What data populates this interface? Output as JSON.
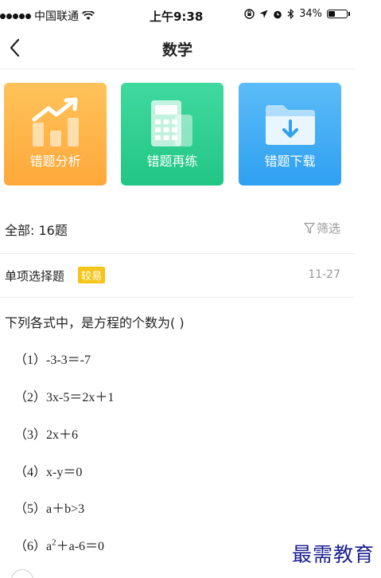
{
  "status_bar": {
    "carrier": "中国联通",
    "time": "上午9:38",
    "battery_text": "34%",
    "battery_level": 0.34
  },
  "nav": {
    "title": "数学",
    "back_icon": "chevron-left-icon"
  },
  "cards": [
    {
      "label": "错题分析",
      "icon": "bar-chart-trend-icon",
      "color": "#ffb347"
    },
    {
      "label": "错题再练",
      "icon": "calculator-icon",
      "color": "#2ecc8f"
    },
    {
      "label": "错题下载",
      "icon": "folder-download-icon",
      "color": "#3aaaf5"
    }
  ],
  "summary": {
    "total": "全部: 16题",
    "filter_label": "筛选",
    "filter_icon": "funnel-icon"
  },
  "question": {
    "type": "单项选择题",
    "difficulty": "较易",
    "date": "11-27",
    "stem": "下列各式中，是方程的个数为( )",
    "options": [
      "（1）-3-3＝-7",
      "（2）3x-5＝2x＋1",
      "（3）2x＋6",
      "（4）x-y＝0",
      "（5）a＋b>3"
    ],
    "option6_prefix": "（6）a",
    "option6_sup": "2",
    "option6_suffix": "＋a-6＝0"
  },
  "watermark": "最需教育"
}
